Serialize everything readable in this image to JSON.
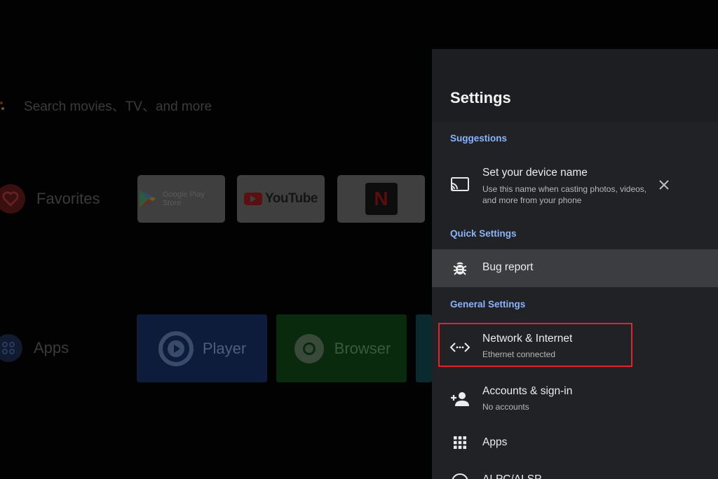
{
  "home": {
    "search_placeholder": "Search movies、TV、and more",
    "favorites_label": "Favorites",
    "apps_label": "Apps",
    "fav_tiles": [
      "Google Play Store",
      "YouTube",
      "N"
    ],
    "app_tiles": [
      "Player",
      "Browser"
    ]
  },
  "settings": {
    "title": "Settings",
    "sections": {
      "suggestions": "Suggestions",
      "quick": "Quick Settings",
      "general": "General Settings"
    },
    "suggestion": {
      "title": "Set your device name",
      "subtitle_line1": "Use this name when casting photos, videos,",
      "subtitle_line2": "and more from your phone"
    },
    "bug_report": "Bug report",
    "network": {
      "title": "Network & Internet",
      "subtitle": "Ethernet connected"
    },
    "accounts": {
      "title": "Accounts & sign-in",
      "subtitle": "No accounts"
    },
    "apps": "Apps",
    "partial_item": "ALPC/ALSP"
  },
  "colors": {
    "panel_bg": "#212226",
    "section_accent": "#8ab4f8",
    "focus_bg": "#3b3d41",
    "annotation_red": "#e0242f"
  }
}
